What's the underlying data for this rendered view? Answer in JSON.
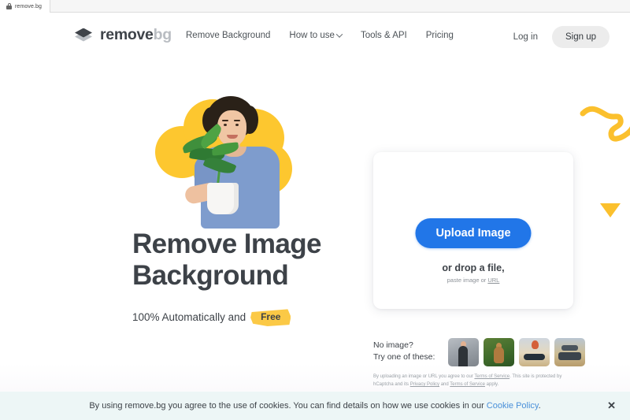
{
  "browser": {
    "tab_title": "remove.bg",
    "lock_icon": "lock-icon"
  },
  "header": {
    "logo": {
      "primary": "remove",
      "secondary": "bg",
      "mark_icon": "layers-diamond-icon"
    },
    "nav": [
      {
        "label": "Remove Background",
        "has_chevron": false
      },
      {
        "label": "How to use",
        "has_chevron": true
      },
      {
        "label": "Tools & API",
        "has_chevron": false
      },
      {
        "label": "Pricing",
        "has_chevron": false
      }
    ],
    "login_label": "Log in",
    "signup_label": "Sign up"
  },
  "hero": {
    "headline_line1": "Remove Image",
    "headline_line2": "Background",
    "subline": "100% Automatically and",
    "badge": "Free",
    "image_alt": "man-holding-plant-photo",
    "decorations": [
      "yellow-squiggle",
      "yellow-triangle",
      "yellow-blob"
    ]
  },
  "upload": {
    "button_label": "Upload Image",
    "drop_text": "or drop a file,",
    "paste_prefix": "paste image or ",
    "paste_link": "URL"
  },
  "samples": {
    "label_line1": "No image?",
    "label_line2": "Try one of these:",
    "thumbs": [
      {
        "name": "sample-woman"
      },
      {
        "name": "sample-deer"
      },
      {
        "name": "sample-car-balloon"
      },
      {
        "name": "sample-jeep"
      }
    ]
  },
  "legal": {
    "part1": "By uploading an image or URL you agree to our ",
    "link1": "Terms of Service",
    "part2": ". This site is protected by hCaptcha and its ",
    "link2": "Privacy Policy",
    "part3": " and ",
    "link3": "Terms of Service",
    "part4": " apply."
  },
  "cookie": {
    "text_before": "By using remove.bg you agree to the use of cookies. You can find details on how we use cookies in our ",
    "link": "Cookie Policy",
    "text_after": ".",
    "close_label": "✕"
  },
  "colors": {
    "accent_blue": "#2176e8",
    "brand_yellow": "#fdc72f",
    "text_dark": "#3d4248",
    "cookie_bg": "#edf6f6",
    "link_blue": "#4a90d9"
  }
}
